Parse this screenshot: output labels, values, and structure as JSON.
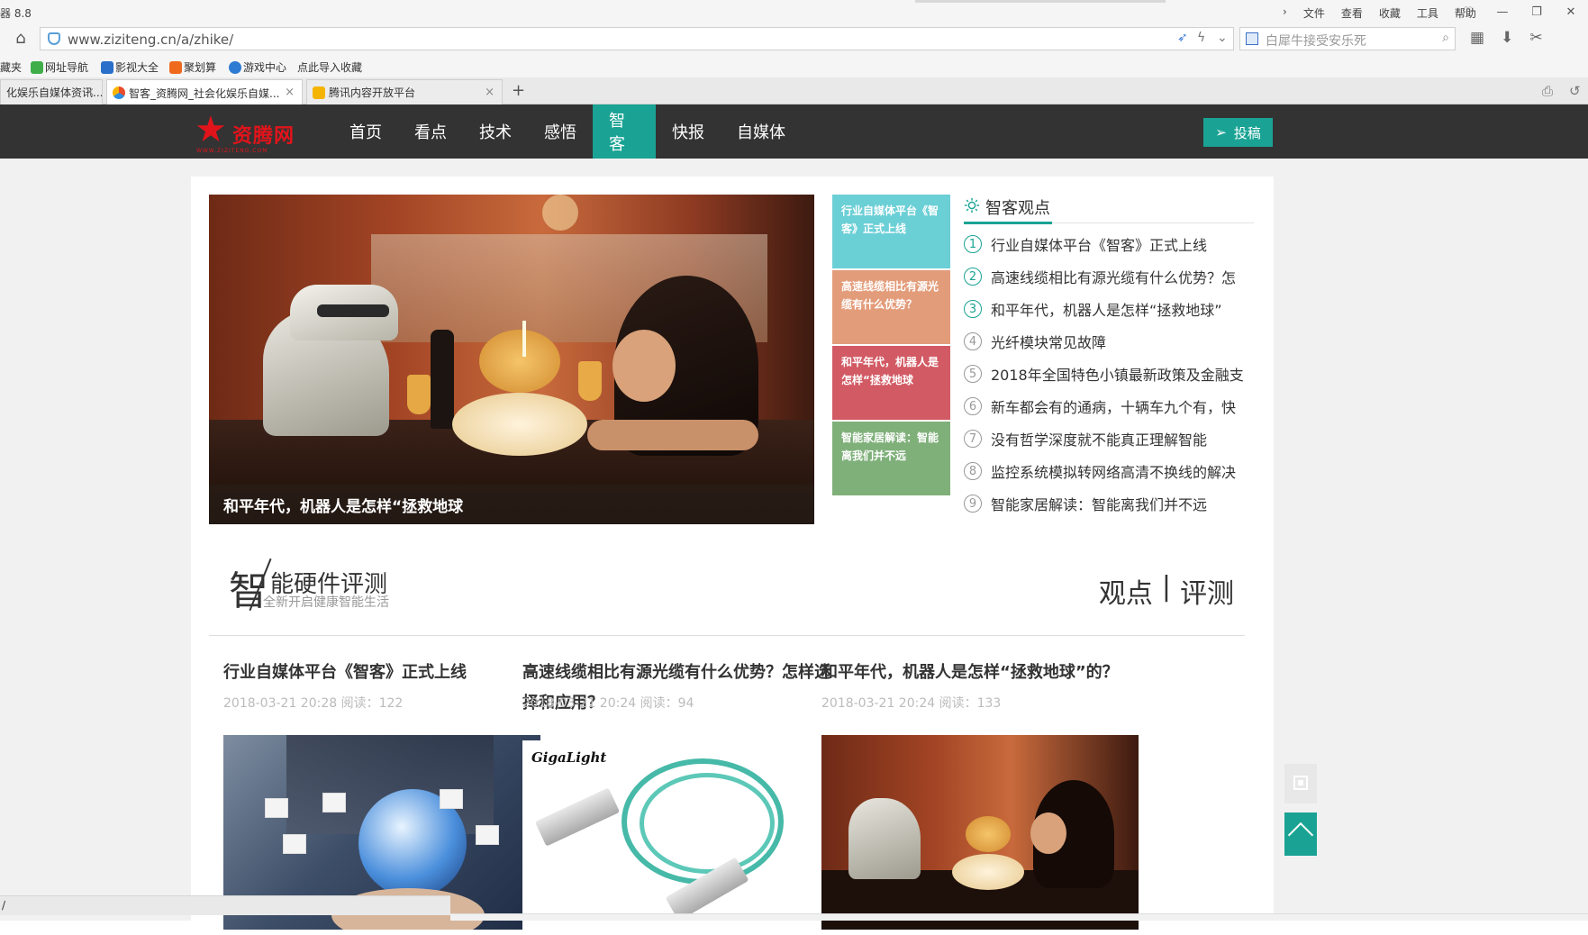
{
  "browser": {
    "title": "器 8.8",
    "menus": [
      "文件",
      "查看",
      "收藏",
      "工具",
      "帮助"
    ],
    "url": "www.ziziteng.cn/a/zhike/",
    "search_placeholder": "白犀牛接受安乐死",
    "favorites": [
      "藏夹",
      "网址导航",
      "影视大全",
      "聚划算",
      "游戏中心",
      "点此导入收藏"
    ],
    "tabs": [
      {
        "label": "化娱乐自媒体资讯...",
        "active": false
      },
      {
        "label": "智客_资腾网_社会化娱乐自媒...",
        "active": true
      },
      {
        "label": "腾讯内容开放平台",
        "active": false
      }
    ],
    "status_text": "/"
  },
  "site": {
    "logo_text": "资腾网",
    "logo_domain": "WWW.ZIZITENG.COM",
    "nav": [
      {
        "label": "首页",
        "active": false
      },
      {
        "label": "看点",
        "active": false
      },
      {
        "label": "技术",
        "active": false
      },
      {
        "label": "感悟",
        "active": false
      },
      {
        "label": "智客",
        "active": true
      },
      {
        "label": "快报",
        "active": false
      },
      {
        "label": "自媒体",
        "active": false
      }
    ],
    "submit_label": "投稿",
    "accent_color": "#1aa394",
    "nav_bg": "#333333",
    "logo_color": "#e1141b"
  },
  "hero": {
    "caption": "和平年代，机器人是怎样“拯救地球"
  },
  "tiles": [
    {
      "text": "行业自媒体平台《智客》正式上线",
      "color": "#6bcfd6"
    },
    {
      "text": "高速线缆相比有源光缆有什么优势？",
      "color": "#e39c7a"
    },
    {
      "text": "和平年代，机器人是怎样“拯救地球",
      "color": "#d25a64"
    },
    {
      "text": "智能家居解读：智能离我们并不远",
      "color": "#7fb07a"
    }
  ],
  "viewpoints": {
    "title": "智客观点",
    "items": [
      {
        "num": "1",
        "text": "行业自媒体平台《智客》正式上线"
      },
      {
        "num": "2",
        "text": "高速线缆相比有源光缆有什么优势？怎"
      },
      {
        "num": "3",
        "text": "和平年代，机器人是怎样“拯救地球”"
      },
      {
        "num": "4",
        "text": "光纤模块常见故障"
      },
      {
        "num": "5",
        "text": "2018年全国特色小镇最新政策及金融支"
      },
      {
        "num": "6",
        "text": "新车都会有的通病，十辆车九个有，快"
      },
      {
        "num": "7",
        "text": "没有哲学深度就不能真正理解智能"
      },
      {
        "num": "8",
        "text": "监控系统模拟转网络高清不换线的解决"
      },
      {
        "num": "9",
        "text": "智能家居解读：智能离我们并不远"
      }
    ]
  },
  "section": {
    "big_char": "智",
    "title": "能硬件评测",
    "subtitle": "全新开启健康智能生活",
    "tab_left": "观点",
    "tab_sep": "|",
    "tab_right": "评测"
  },
  "cards": [
    {
      "title": "行业自媒体平台《智客》正式上线",
      "meta": "2018-03-21 20:28 阅读：122"
    },
    {
      "title": "高速线缆相比有源光缆有什么优势？怎样选择和应用？",
      "meta": "2018-03-21 20:24 阅读：94",
      "image_brand": "GigaLight"
    },
    {
      "title": "和平年代，机器人是怎样“拯救地球”的？",
      "meta": "2018-03-21 20:24 阅读：133"
    }
  ]
}
